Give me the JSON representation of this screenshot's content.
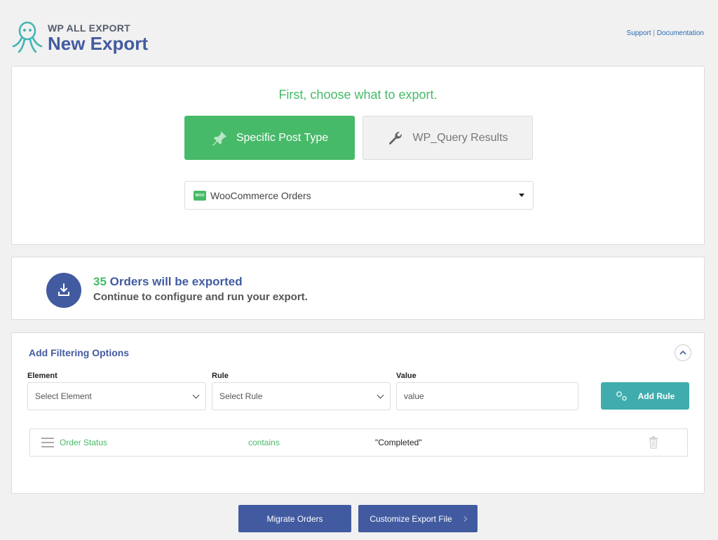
{
  "header": {
    "brand_small": "WP ALL EXPORT",
    "title": "New Export",
    "support_link": "Support",
    "separator": "|",
    "documentation_link": "Documentation"
  },
  "choose": {
    "title": "First, choose what to export.",
    "specific_post_type_label": "Specific Post Type",
    "wp_query_label": "WP_Query Results",
    "selected_post_type": "WooCommerce Orders",
    "woo_badge": "WOO"
  },
  "summary": {
    "count": "35",
    "count_text": "Orders will be exported",
    "continue_text": "Continue to configure and run your export."
  },
  "filters": {
    "title": "Add Filtering Options",
    "element_label": "Element",
    "rule_label": "Rule",
    "value_label": "Value",
    "element_placeholder": "Select Element",
    "rule_placeholder": "Select Rule",
    "value_placeholder": "value",
    "add_rule_label": "Add Rule",
    "rules": [
      {
        "element": "Order Status",
        "rule": "contains",
        "value": "\"Completed\""
      }
    ]
  },
  "footer": {
    "migrate_label": "Migrate Orders",
    "customize_label": "Customize Export File"
  },
  "colors": {
    "brand_blue": "#425ba0",
    "accent_green": "#46ba69",
    "teal": "#40acad"
  }
}
